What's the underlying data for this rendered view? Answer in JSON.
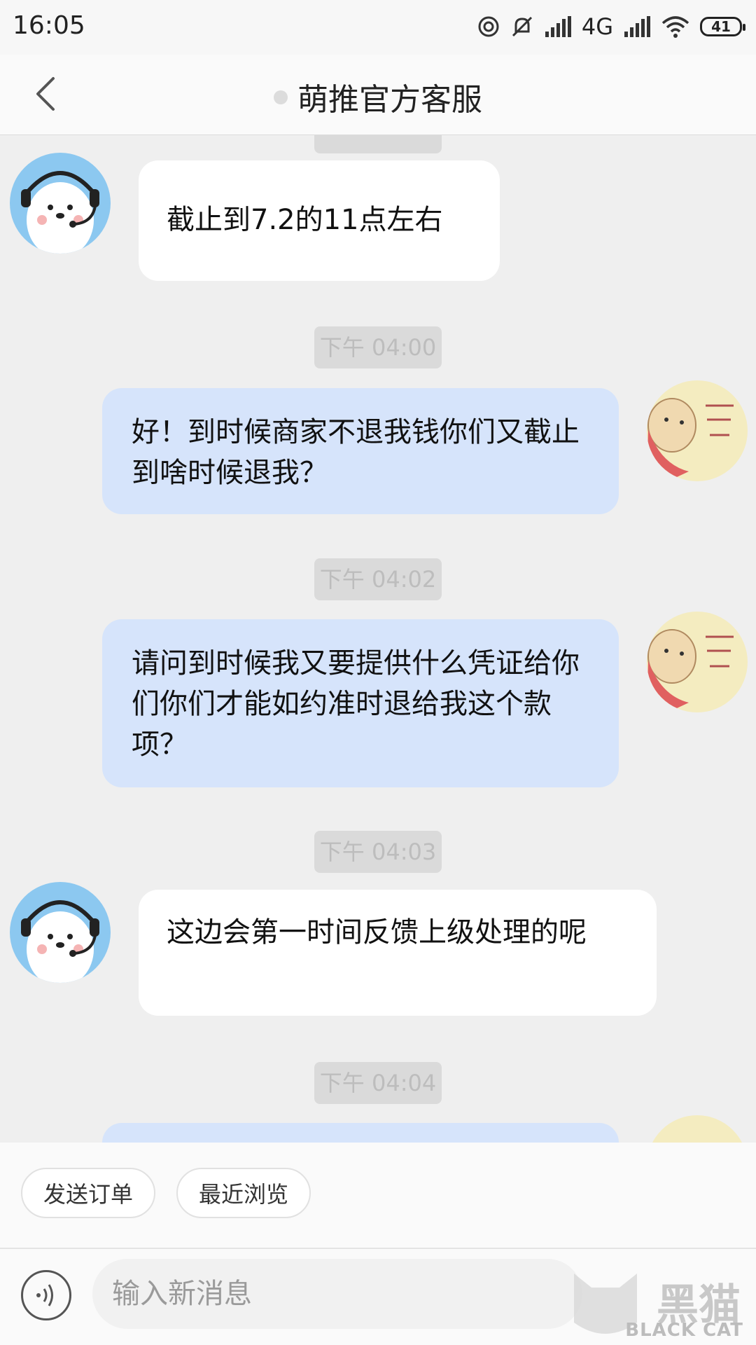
{
  "status_bar": {
    "time": "16:05",
    "network": "4G",
    "battery": "41"
  },
  "header": {
    "title": "萌推官方客服"
  },
  "messages": [
    {
      "side": "in",
      "text": "截止到7.2的11点左右"
    },
    {
      "timestamp": "下午 04:00"
    },
    {
      "side": "out",
      "text": "好！到时候商家不退我钱你们又截止到啥时候退我？"
    },
    {
      "timestamp": "下午 04:02"
    },
    {
      "side": "out",
      "text": "请问到时候我又要提供什么凭证给你们你们才能如约准时退给我这个款项？"
    },
    {
      "timestamp": "下午 04:03"
    },
    {
      "side": "in",
      "text": "这边会第一时间反馈上级处理的呢"
    },
    {
      "timestamp": "下午 04:04"
    }
  ],
  "quick_actions": [
    "发送订单",
    "最近浏览"
  ],
  "composer": {
    "placeholder": "输入新消息"
  },
  "watermark": {
    "logo_text": "黑猫",
    "brand": "BLACK CAT"
  },
  "colors": {
    "incoming_bubble": "#ffffff",
    "outgoing_bubble": "#d6e4fb",
    "background": "#efefef"
  }
}
